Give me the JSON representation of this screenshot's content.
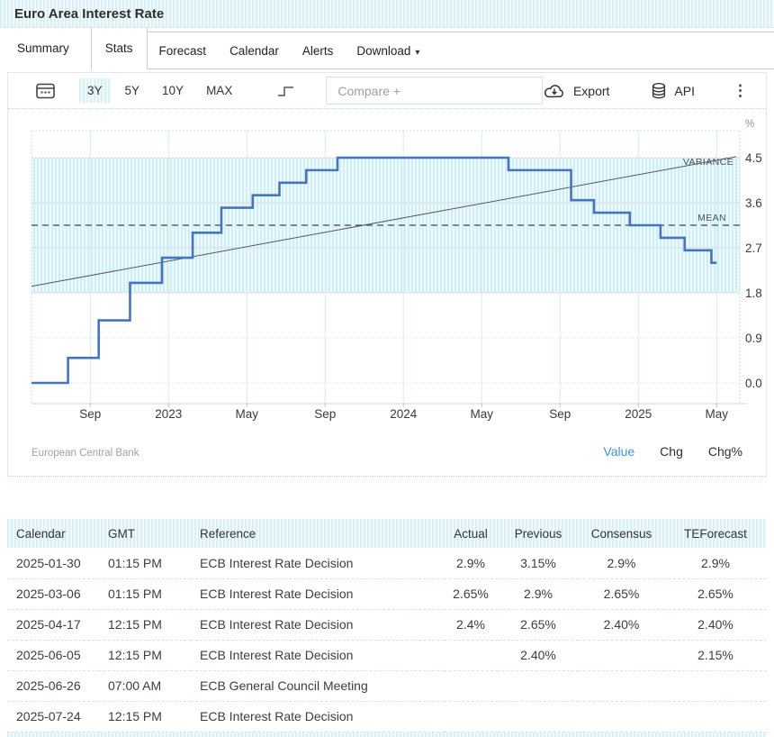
{
  "header": {
    "title": "Euro Area Interest Rate"
  },
  "tabs": {
    "items": [
      {
        "label": "Summary"
      },
      {
        "label": "Stats",
        "active": true
      },
      {
        "label": "Forecast"
      },
      {
        "label": "Calendar"
      },
      {
        "label": "Alerts"
      },
      {
        "label": "Download"
      }
    ]
  },
  "toolbar": {
    "ranges": [
      "3Y",
      "5Y",
      "10Y",
      "MAX"
    ],
    "active_range": "3Y",
    "compare_placeholder": "Compare +",
    "export_label": "Export",
    "api_label": "API"
  },
  "chart_data": {
    "type": "line",
    "subtype": "step",
    "title": "Euro Area Interest Rate",
    "unit": "%",
    "source": "European Central Bank",
    "series": [
      {
        "name": "ECB Interest Rate Decision",
        "points": [
          [
            "2022-06-01",
            0.0
          ],
          [
            "2022-07-27",
            0.5
          ],
          [
            "2022-09-14",
            1.25
          ],
          [
            "2022-11-02",
            2.0
          ],
          [
            "2022-12-21",
            2.5
          ],
          [
            "2023-02-08",
            3.0
          ],
          [
            "2023-03-22",
            3.5
          ],
          [
            "2023-05-10",
            3.75
          ],
          [
            "2023-06-21",
            4.0
          ],
          [
            "2023-08-02",
            4.25
          ],
          [
            "2023-09-20",
            4.5
          ],
          [
            "2024-06-12",
            4.25
          ],
          [
            "2024-09-18",
            3.65
          ],
          [
            "2024-10-23",
            3.4
          ],
          [
            "2024-12-18",
            3.15
          ],
          [
            "2025-02-05",
            2.9
          ],
          [
            "2025-03-12",
            2.65
          ],
          [
            "2025-04-23",
            2.4
          ]
        ],
        "end": "2025-05-01"
      }
    ],
    "y_ticks": [
      0.0,
      0.9,
      1.8,
      2.7,
      3.6,
      4.5
    ],
    "ylim": [
      -0.41,
      5.04
    ],
    "x_ticks": [
      {
        "label": "Sep",
        "date": "2022-09-01"
      },
      {
        "label": "2023",
        "date": "2023-01-01"
      },
      {
        "label": "May",
        "date": "2023-05-01"
      },
      {
        "label": "Sep",
        "date": "2023-09-01"
      },
      {
        "label": "2024",
        "date": "2024-01-01"
      },
      {
        "label": "May",
        "date": "2024-05-01"
      },
      {
        "label": "Sep",
        "date": "2024-09-01"
      },
      {
        "label": "2025",
        "date": "2025-01-01"
      },
      {
        "label": "May",
        "date": "2025-05-01"
      }
    ],
    "band": {
      "from": 1.8,
      "to": 4.5,
      "label": "VARIANCE"
    },
    "mean": {
      "value": 3.15,
      "label": "MEAN"
    },
    "trend": {
      "label": "VARIANCE",
      "start_value": 1.93,
      "end_value": 4.52
    },
    "grid": true,
    "legend_position": "bottom-right",
    "legend": [
      "Value",
      "Chg",
      "Chg%"
    ],
    "active_legend": "Value",
    "colors": {
      "line": "#4575bd",
      "band_stripe": "#cfeef5",
      "band_bg": "#eef9fb",
      "vgrid": "#d5eef3",
      "hgrid_low": "#c7e7ee",
      "hgrid_band": "#dfb9bc",
      "mean_line": "#3c4852",
      "trend_line": "#55595c",
      "axis_text": "#3a3a3a",
      "active_link": "#4a90e2"
    }
  },
  "table": {
    "columns": [
      "Calendar",
      "GMT",
      "Reference",
      "Actual",
      "Previous",
      "Consensus",
      "TEForecast"
    ],
    "rows": [
      [
        "2025-01-30",
        "01:15 PM",
        "ECB Interest Rate Decision",
        "2.9%",
        "3.15%",
        "2.9%",
        "2.9%"
      ],
      [
        "2025-03-06",
        "01:15 PM",
        "ECB Interest Rate Decision",
        "2.65%",
        "2.9%",
        "2.65%",
        "2.65%"
      ],
      [
        "2025-04-17",
        "12:15 PM",
        "ECB Interest Rate Decision",
        "2.4%",
        "2.65%",
        "2.40%",
        "2.40%"
      ],
      [
        "2025-06-05",
        "12:15 PM",
        "ECB Interest Rate Decision",
        "",
        "2.40%",
        "",
        "2.15%"
      ],
      [
        "2025-06-26",
        "07:00 AM",
        "ECB General Council Meeting",
        "",
        "",
        "",
        ""
      ],
      [
        "2025-07-24",
        "12:15 PM",
        "ECB Interest Rate Decision",
        "",
        "",
        "",
        ""
      ]
    ]
  }
}
